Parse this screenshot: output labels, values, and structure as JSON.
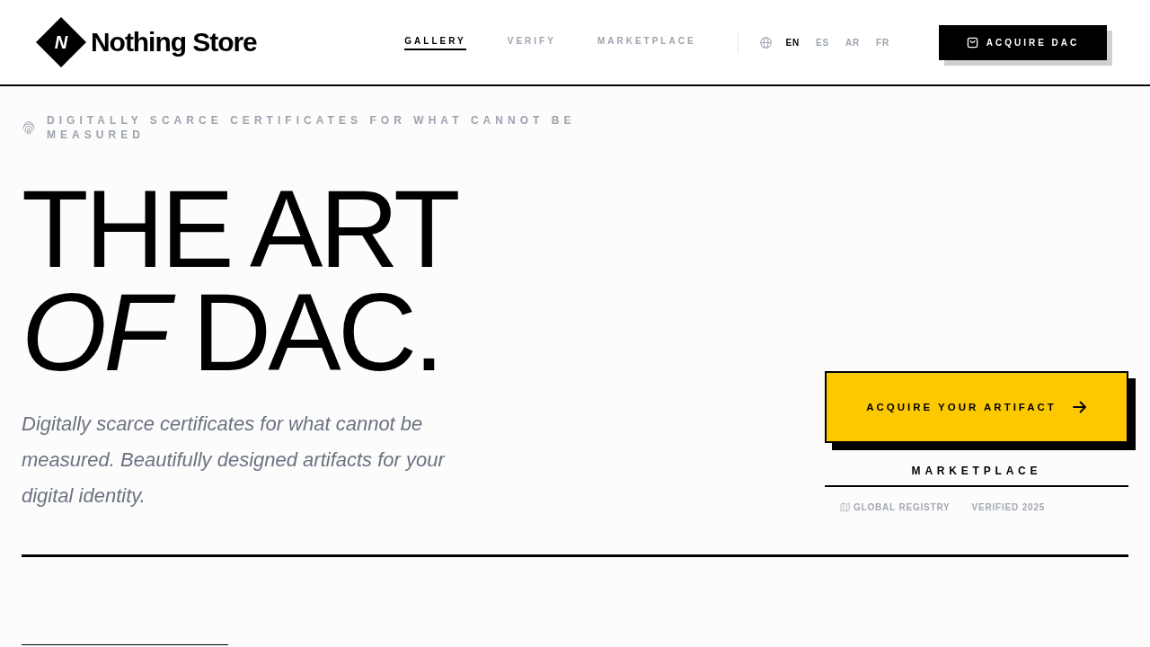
{
  "header": {
    "logo": {
      "mark": "N",
      "text": "Nothing Store"
    },
    "nav": [
      {
        "label": "GALLERY",
        "selected": true
      },
      {
        "label": "VERIFY",
        "selected": false
      },
      {
        "label": "MARKETPLACE",
        "selected": false
      }
    ],
    "languages": [
      {
        "code": "EN",
        "selected": true
      },
      {
        "code": "ES",
        "selected": false
      },
      {
        "code": "AR",
        "selected": false
      },
      {
        "code": "FR",
        "selected": false
      }
    ],
    "cta": {
      "label": "ACQUIRE DAC"
    }
  },
  "hero": {
    "tagline": "DIGITALLY SCARCE CERTIFICATES FOR WHAT CANNOT BE MEASURED",
    "headline": [
      "THE ART",
      "*OF* DAC."
    ],
    "description": "Digitally scarce certificates for what cannot be measured. Beautifully designed artifacts for your digital identity.",
    "primary_button": {
      "label": "ACQUIRE YOUR ARTIFACT"
    },
    "secondary_link": {
      "label": "MARKETPLACE"
    },
    "stats": [
      {
        "kind": "map",
        "label": "GLOBAL REGISTRY"
      },
      {
        "kind": "plain",
        "label": "VERIFIED 2025"
      }
    ]
  }
}
